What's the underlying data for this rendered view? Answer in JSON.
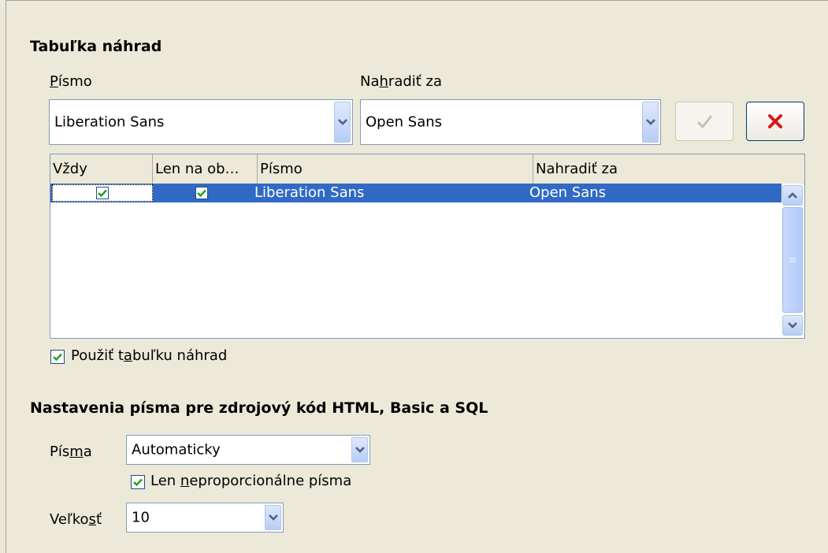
{
  "replacement_table": {
    "heading": "Tabuľka náhrad",
    "font_label": "Písmo",
    "replace_label": "Nahradiť za",
    "font_value": "Liberation Sans",
    "replace_value": "Open Sans",
    "columns": [
      "Vždy",
      "Len na ob…",
      "Písmo",
      "Nahradiť za"
    ],
    "rows": [
      {
        "always": true,
        "screen_only": true,
        "font": "Liberation Sans",
        "replace_with": "Open Sans"
      }
    ],
    "apply_label": "Použiť tabuľku náhrad",
    "apply_checked": true
  },
  "source_fonts": {
    "heading": "Nastavenia písma pre zdrojový kód HTML, Basic a SQL",
    "fonts_label": "Písma",
    "fonts_value": "Automaticky",
    "mono_label": "Len neproporcionálne písma",
    "mono_checked": true,
    "size_label": "Veľkosť",
    "size_value": "10"
  },
  "colors": {
    "accent": "#316ac5",
    "dialog_bg": "#ece9d8",
    "check_green": "#21a121",
    "delete_red": "#d41a1a"
  },
  "icons": [
    "chevron-down-icon",
    "checkmark-icon",
    "delete-x-icon",
    "scroll-up-icon",
    "scroll-down-icon",
    "checkbox-checked-icon"
  ]
}
